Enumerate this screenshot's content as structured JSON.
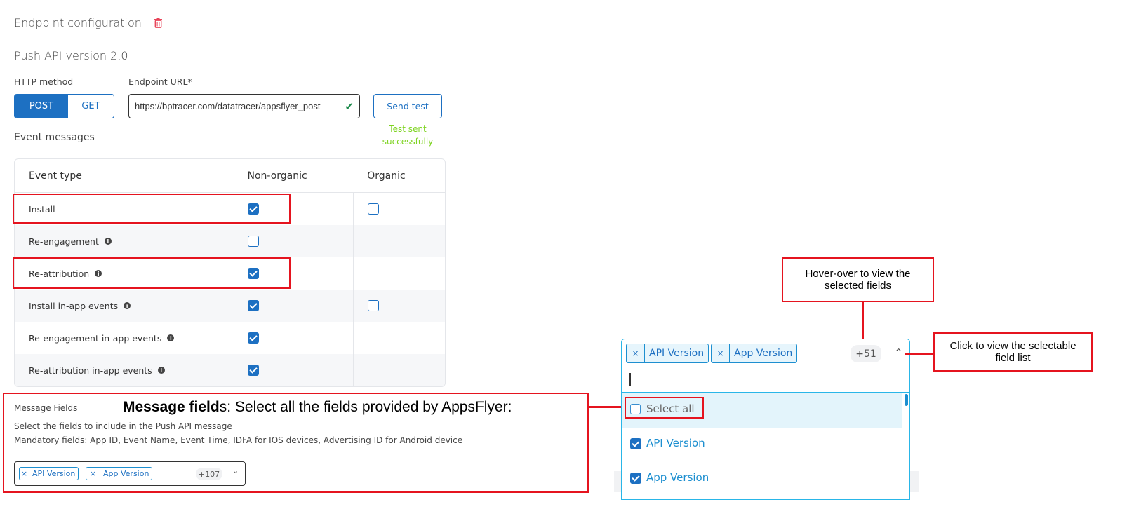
{
  "header": {
    "title": "Endpoint configuration",
    "delete_icon": "trash-icon",
    "subtitle": "Push API version 2.0"
  },
  "http": {
    "label": "HTTP method",
    "options": [
      "POST",
      "GET"
    ],
    "selected": "POST"
  },
  "endpoint": {
    "label": "Endpoint URL*",
    "value": "https://bptracer.com/datatracer/appsflyer_post",
    "valid_icon": "check-icon"
  },
  "send_test": {
    "label": "Send test",
    "status": "Test sent successfully",
    "status_color": "#7ed321"
  },
  "events": {
    "label": "Event messages",
    "columns": [
      "Event type",
      "Non-organic",
      "Organic"
    ],
    "rows": [
      {
        "name": "Install",
        "info": false,
        "non_organic": true,
        "organic": false,
        "has_organic": true
      },
      {
        "name": "Re-engagement",
        "info": true,
        "non_organic": false,
        "has_organic": false
      },
      {
        "name": "Re-attribution",
        "info": true,
        "non_organic": true,
        "has_organic": false
      },
      {
        "name": "Install in-app events",
        "info": true,
        "non_organic": true,
        "organic": false,
        "has_organic": true
      },
      {
        "name": "Re-engagement in-app events",
        "info": true,
        "non_organic": true,
        "has_organic": false
      },
      {
        "name": "Re-attribution in-app events",
        "info": true,
        "non_organic": true,
        "has_organic": false
      }
    ]
  },
  "message_fields": {
    "label": "Message Fields",
    "description": "Select the fields to include in the Push API message",
    "mandatory": "Mandatory fields: App ID, Event Name, Event Time, IDFA for IOS devices, Advertising ID for Android device",
    "tags": [
      "API Version",
      "App Version"
    ],
    "more": "+107"
  },
  "dropdown": {
    "tags": [
      "API Version",
      "App Version"
    ],
    "more": "+51",
    "select_all": "Select all",
    "options": [
      {
        "label": "API Version",
        "checked": true
      },
      {
        "label": "App Version",
        "checked": true
      }
    ]
  },
  "annotations": {
    "message_bold": "Message field",
    "message_bold2": "s",
    "message_rest": ": Select all the fields provided by AppsFlyer:",
    "hover": "Hover-over to view the selected fields",
    "click": "Click to view the selectable field list"
  },
  "colors": {
    "accent": "#1d70c2",
    "annotation": "#e5141f",
    "dropdown_border": "#29b6e8"
  }
}
